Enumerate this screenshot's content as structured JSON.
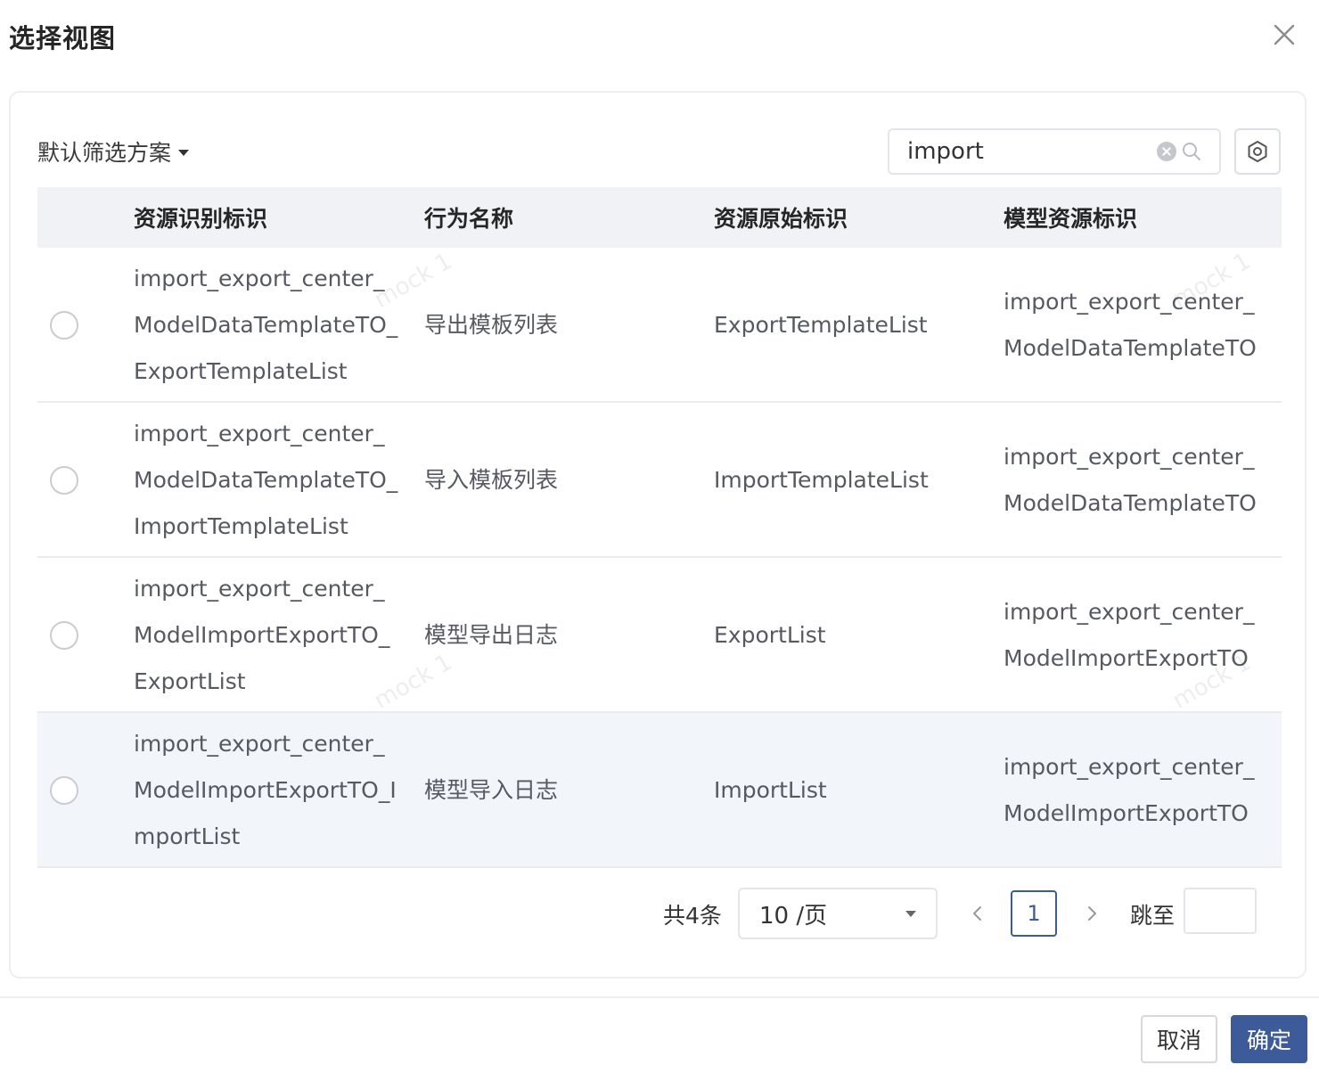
{
  "dialog": {
    "title": "选择视图",
    "cancel_label": "取消",
    "confirm_label": "确定"
  },
  "toolbar": {
    "filter_scheme": "默认筛选方案",
    "search_value": "import"
  },
  "table": {
    "headers": [
      "资源识别标识",
      "行为名称",
      "资源原始标识",
      "模型资源标识"
    ],
    "rows": [
      {
        "id": "import_export_center_ModelDataTemplateTO_ExportTemplateList",
        "action": "导出模板列表",
        "origin": "ExportTemplateList",
        "model": "import_export_center_ModelDataTemplateTO"
      },
      {
        "id": "import_export_center_ModelDataTemplateTO_ImportTemplateList",
        "action": "导入模板列表",
        "origin": "ImportTemplateList",
        "model": "import_export_center_ModelDataTemplateTO"
      },
      {
        "id": "import_export_center_ModelImportExportTO_ExportList",
        "action": "模型导出日志",
        "origin": "ExportList",
        "model": "import_export_center_ModelImportExportTO"
      },
      {
        "id": "import_export_center_ModelImportExportTO_ImportList",
        "action": "模型导入日志",
        "origin": "ImportList",
        "model": "import_export_center_ModelImportExportTO"
      }
    ]
  },
  "pagination": {
    "total_label": "共4条",
    "page_size": "10 /页",
    "current_page": "1",
    "jump_label": "跳至"
  },
  "watermark_text": "mock 1",
  "colors": {
    "primary": "#3d5a99",
    "header_bg": "#f0f2f5",
    "hover_row_bg": "#f2f5f9"
  }
}
